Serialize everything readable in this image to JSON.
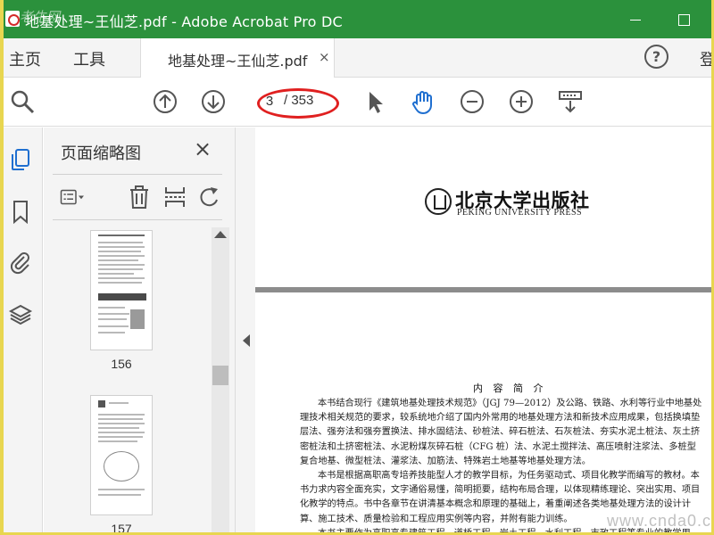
{
  "window": {
    "title": "地基处理~王仙芝.pdf - Adobe Acrobat Pro DC",
    "watermark": "老牛网"
  },
  "menu": {
    "home": "主页",
    "tools": "工具",
    "sign_in": "登"
  },
  "tab": {
    "label": "地基处理~王仙芝.pdf",
    "close": "×"
  },
  "toolbar": {
    "page_current": "3",
    "page_total": "/ 353",
    "icons": [
      "search-icon",
      "page-up-icon",
      "page-down-icon",
      "select-pointer-icon",
      "hand-tool-icon",
      "zoom-out-icon",
      "zoom-in-icon",
      "page-fit-icon"
    ],
    "active_color": "#1f6fd0",
    "annotation_color": "#e02020"
  },
  "sidebar": {
    "icons": [
      "pages-thumbnail-icon",
      "bookmark-icon",
      "attachment-icon",
      "layers-icon"
    ]
  },
  "thumbnails_panel": {
    "title": "页面缩略图",
    "close": "×",
    "tool_icons": [
      "thumbnail-options-icon",
      "delete-page-icon",
      "extract-page-icon",
      "rotate-page-icon"
    ],
    "pages": [
      {
        "label": "156"
      },
      {
        "label": "157"
      }
    ]
  },
  "document": {
    "publisher_cn": "北京大学出版社",
    "publisher_en": "PEKING UNIVERSITY PRESS",
    "heading": "内 容 简 介",
    "paragraphs": [
      "本书结合现行《建筑地基处理技术规范》（JGJ 79—2012）及公路、铁路、水利等行业中地基处理技术相关规范的要求，较系统地介绍了国内外常用的地基处理方法和新技术应用成果，包括换填垫层法、强夯法和强夯置换法、排水固结法、砂桩法、碎石桩法、石灰桩法、夯实水泥土桩法、灰土挤密桩法和土挤密桩法、水泥粉煤灰碎石桩（CFG 桩）法、水泥土搅拌法、高压喷射注浆法、多桩型复合地基、微型桩法、灌浆法、加筋法、特殊岩土地基等地基处理方法。",
      "本书是根据高职高专培养技能型人才的教学目标，为任务驱动式、项目化教学而编写的教材。本书力求内容全面充实，文字通俗易懂，简明扼要，结构布局合理，以体现精练理论、突出实用、项目化教学的特点。书中各章节在讲清基本概念和原理的基础上，着重阐述各类地基处理方法的设计计算、施工技术、质量检验和工程应用实例等内容，并附有能力训练。",
      "本书主要作为高职高专建筑工程、道桥工程、岩土工程、水利工程、市政工程等专业的教学用书，也可供其他相关专业的师生及工程技术人员学习参考。"
    ],
    "watermark_url": "www.cnda0.com"
  }
}
